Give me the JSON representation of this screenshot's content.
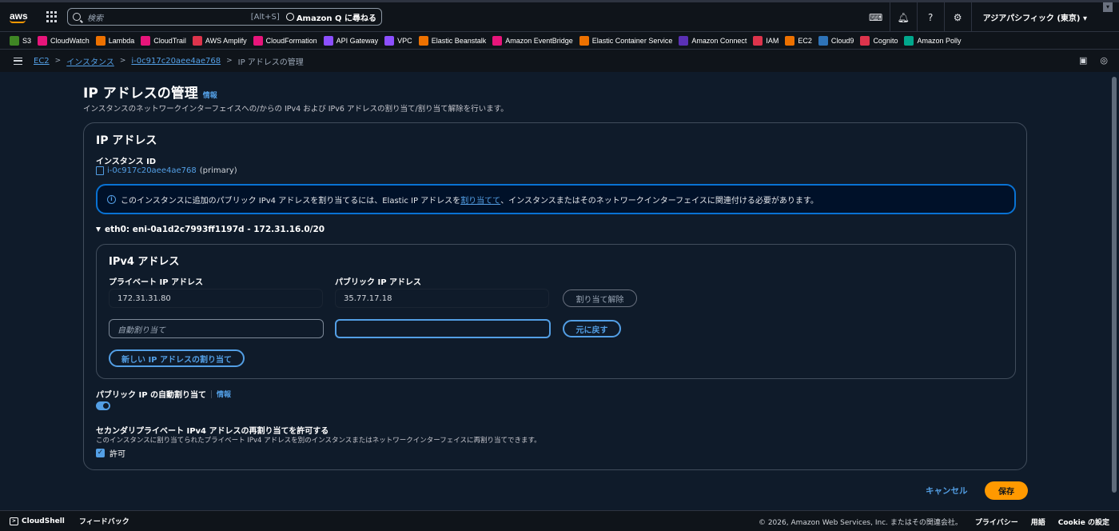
{
  "topnav": {
    "logo_text": "aws",
    "search_placeholder": "検索",
    "search_shortcut": "[Alt+S]",
    "amazon_q_label": "Amazon Q に尋ねる",
    "region_label": "アジアパシフィック (東京) ▾"
  },
  "favorites": [
    {
      "label": "S3",
      "color": "#3f8624"
    },
    {
      "label": "CloudWatch",
      "color": "#e7157b"
    },
    {
      "label": "Lambda",
      "color": "#ed7100"
    },
    {
      "label": "CloudTrail",
      "color": "#e7157b"
    },
    {
      "label": "AWS Amplify",
      "color": "#dd344c"
    },
    {
      "label": "CloudFormation",
      "color": "#e7157b"
    },
    {
      "label": "API Gateway",
      "color": "#8c4fff"
    },
    {
      "label": "VPC",
      "color": "#8c4fff"
    },
    {
      "label": "Elastic Beanstalk",
      "color": "#ed7100"
    },
    {
      "label": "Amazon EventBridge",
      "color": "#e7157b"
    },
    {
      "label": "Elastic Container Service",
      "color": "#ed7100"
    },
    {
      "label": "Amazon Connect",
      "color": "#5a30b5"
    },
    {
      "label": "IAM",
      "color": "#dd344c"
    },
    {
      "label": "EC2",
      "color": "#ed7100"
    },
    {
      "label": "Cloud9",
      "color": "#2e73b8"
    },
    {
      "label": "Cognito",
      "color": "#dd344c"
    },
    {
      "label": "Amazon Polly",
      "color": "#01a88d"
    }
  ],
  "breadcrumb": {
    "ec2": "EC2",
    "instances": "インスタンス",
    "instance_id": "i-0c917c20aee4ae768",
    "current": "IP アドレスの管理"
  },
  "page": {
    "title": "IP アドレスの管理",
    "info": "情報",
    "description": "インスタンスのネットワークインターフェイスへの/からの IPv4 および IPv6 アドレスの割り当て/割り当て解除を行います。"
  },
  "card": {
    "title": "IP アドレス",
    "instance_label": "インスタンス ID",
    "instance_id": "i-0c917c20aee4ae768",
    "instance_suffix": "(primary)",
    "alert_prefix": "このインスタンスに追加のパブリック IPv4 アドレスを割り当てるには、Elastic IP アドレスを",
    "alert_link": "割り当てて",
    "alert_suffix": "、インスタンスまたはそのネットワークインターフェイスに関連付ける必要があります。",
    "eni_label": "eth0: eni-0a1d2c7993ff1197d - 172.31.16.0/20"
  },
  "ipv4": {
    "title": "IPv4 アドレス",
    "private_label": "プライベート IP アドレス",
    "public_label": "パブリック IP アドレス",
    "private_value": "172.31.31.80",
    "public_value": "35.77.17.18",
    "unassign_button": "割り当て解除",
    "auto_assign_placeholder": "自動割り当て",
    "public_input_value": "",
    "revert_button": "元に戻す",
    "new_ip_button": "新しい IP アドレスの割り当て"
  },
  "settings": {
    "auto_public_label": "パブリック IP の自動割り当て",
    "auto_public_info": "情報",
    "auto_public_enabled": true,
    "secondary_label": "セカンダリプライベート IPv4 アドレスの再割り当てを許可する",
    "secondary_desc": "このインスタンスに割り当てられたプライベート IPv4 アドレスを別のインスタンスまたはネットワークインターフェイスに再割り当てできます。",
    "allow_label": "許可",
    "allow_checked": true
  },
  "actions": {
    "cancel": "キャンセル",
    "save": "保存"
  },
  "footer": {
    "cloudshell": "CloudShell",
    "feedback": "フィードバック",
    "copyright": "© 2026, Amazon Web Services, Inc. またはその関連会社。",
    "privacy": "プライバシー",
    "terms": "用語",
    "cookie": "Cookie の設定"
  }
}
